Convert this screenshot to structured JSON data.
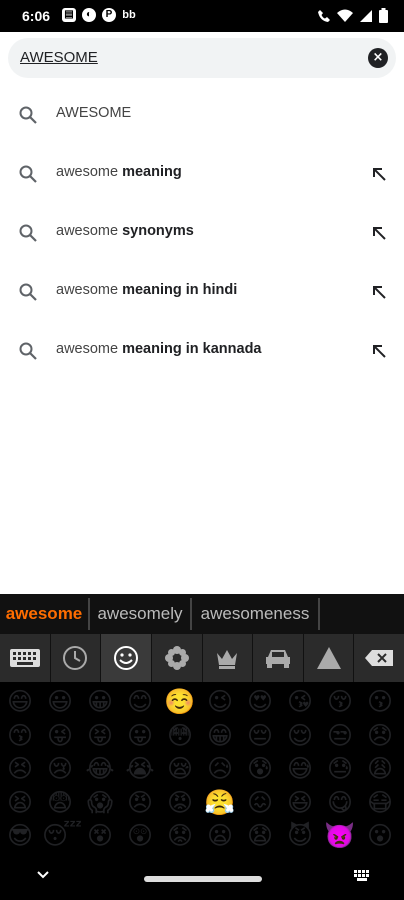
{
  "status_bar": {
    "time": "6:06",
    "left_icons": [
      "notification-icon",
      "photo-icon",
      "pinterest-icon",
      "bb-icon"
    ],
    "right_icons": [
      "call-icon",
      "wifi-icon",
      "signal-icon",
      "battery-icon"
    ],
    "glyphs": {
      "notification": "▤",
      "photo": "◐",
      "pinterest": "P",
      "bb": "bb"
    }
  },
  "search": {
    "query": "AWESOME",
    "clear_icon": "×"
  },
  "suggestions": [
    {
      "prefix": "AWESOME",
      "bold": "",
      "fill": false
    },
    {
      "prefix": "awesome ",
      "bold": "meaning",
      "fill": true
    },
    {
      "prefix": "awesome ",
      "bold": "synonyms",
      "fill": true
    },
    {
      "prefix": "awesome ",
      "bold": "meaning in hindi",
      "fill": true
    },
    {
      "prefix": "awesome ",
      "bold": "meaning in kannada",
      "fill": true
    }
  ],
  "keyboard": {
    "word_suggestions": [
      "awesome",
      "awesomely",
      "awesomeness"
    ],
    "active_suggestion_color": "#ff6d00",
    "tabs": [
      "keyboard-icon",
      "recent-icon",
      "smiley-icon",
      "flower-icon",
      "crown-icon",
      "car-icon",
      "triangle-icon",
      "backspace-icon"
    ],
    "active_tab": 2,
    "emoji_rows": [
      [
        "😄",
        "😃",
        "😀",
        "😊",
        "☺️",
        "😉",
        "😍",
        "😘",
        "😚",
        "😗"
      ],
      [
        "😙",
        "😜",
        "😝",
        "😛",
        "😳",
        "😁",
        "😔",
        "😌",
        "😒",
        "😞"
      ],
      [
        "😣",
        "😢",
        "😂",
        "😭",
        "😪",
        "😥",
        "😰",
        "😅",
        "😓",
        "😩"
      ],
      [
        "😫",
        "😨",
        "😱",
        "😠",
        "😡",
        "😤",
        "😖",
        "😆",
        "😋",
        "😷"
      ],
      [
        "😎",
        "😴",
        "😵",
        "😲",
        "😟",
        "😦",
        "😧",
        "😈",
        "👿",
        "😮"
      ]
    ]
  }
}
